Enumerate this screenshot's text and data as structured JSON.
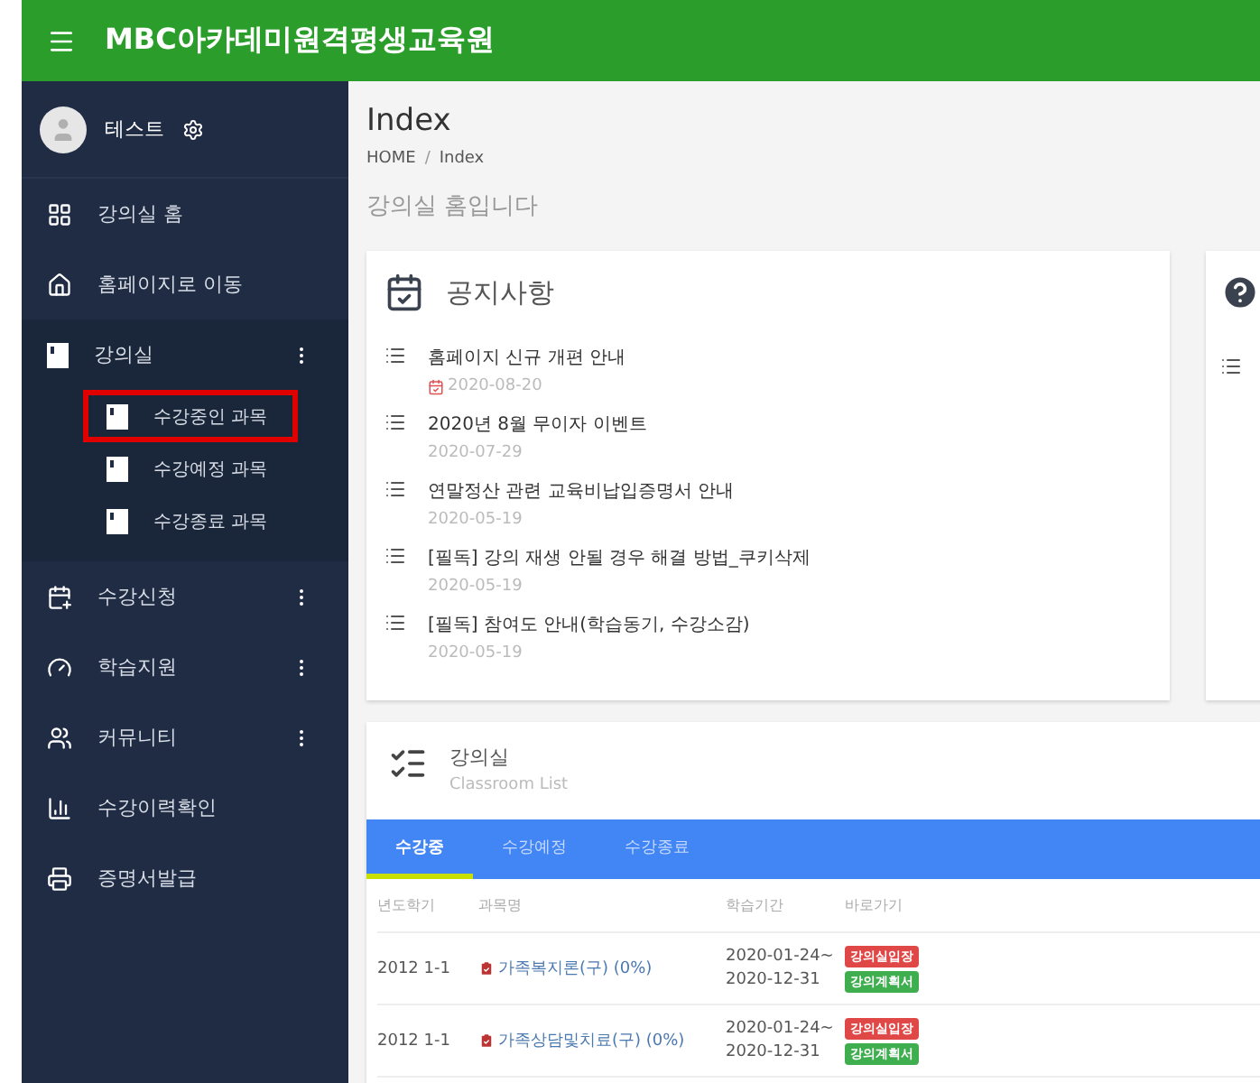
{
  "header": {
    "title": "MBC아카데미원격평생교육원"
  },
  "user": {
    "name": "테스트"
  },
  "sidebar": {
    "items": [
      {
        "label": "강의실 홈",
        "kind": "dashboard",
        "has_menu": false,
        "expanded": false
      },
      {
        "label": "홈페이지로 이동",
        "kind": "home",
        "has_menu": false,
        "expanded": false
      },
      {
        "label": "강의실",
        "kind": "book",
        "has_menu": true,
        "expanded": true,
        "children": [
          {
            "label": "수강중인 과목",
            "highlighted": true
          },
          {
            "label": "수강예정 과목",
            "highlighted": false
          },
          {
            "label": "수강종료 과목",
            "highlighted": false
          }
        ]
      },
      {
        "label": "수강신청",
        "kind": "calendar",
        "has_menu": true,
        "expanded": false
      },
      {
        "label": "학습지원",
        "kind": "gauge",
        "has_menu": true,
        "expanded": false
      },
      {
        "label": "커뮤니티",
        "kind": "users",
        "has_menu": true,
        "expanded": false
      },
      {
        "label": "수강이력확인",
        "kind": "chart",
        "has_menu": false,
        "expanded": false
      },
      {
        "label": "증명서발급",
        "kind": "printer",
        "has_menu": false,
        "expanded": false
      }
    ]
  },
  "page": {
    "title": "Index",
    "breadcrumb": [
      "HOME",
      "Index"
    ],
    "breadcrumb_separator": "/",
    "subtitle": "강의실 홈입니다"
  },
  "notices": {
    "title": "공지사항",
    "items": [
      {
        "title": "홈페이지 신규 개편 안내",
        "date": "2020-08-20",
        "new": true
      },
      {
        "title": "2020년 8월 무이자 이벤트",
        "date": "2020-07-29",
        "new": false
      },
      {
        "title": "연말정산 관련 교육비납입증명서 안내",
        "date": "2020-05-19",
        "new": false
      },
      {
        "title": "[필독] 강의 재생 안될 경우 해결 방법_쿠키삭제",
        "date": "2020-05-19",
        "new": false
      },
      {
        "title": "[필독] 참여도 안내(학습동기, 수강소감)",
        "date": "2020-05-19",
        "new": false
      }
    ]
  },
  "classroom": {
    "title": "강의실",
    "subtitle": "Classroom List",
    "tabs": [
      {
        "label": "수강중",
        "selected": true
      },
      {
        "label": "수강예정",
        "selected": false
      },
      {
        "label": "수강종료",
        "selected": false
      }
    ],
    "columns": [
      "년도학기",
      "과목명",
      "학습기간",
      "바로가기"
    ],
    "rows": [
      {
        "term": "2012 1-1",
        "course": "가족복지론(구) (0%)",
        "period_start": "2020-01-24~",
        "period_end": "2020-12-31",
        "buttons": [
          {
            "label": "강의실입장",
            "color": "#e04848"
          },
          {
            "label": "강의계획서",
            "color": "#3fae4f"
          }
        ]
      },
      {
        "term": "2012 1-1",
        "course": "가족상담및치료(구) (0%)",
        "period_start": "2020-01-24~",
        "period_end": "2020-12-31",
        "buttons": [
          {
            "label": "강의실입장",
            "color": "#e04848"
          },
          {
            "label": "강의계획서",
            "color": "#3fae4f"
          }
        ]
      }
    ]
  }
}
